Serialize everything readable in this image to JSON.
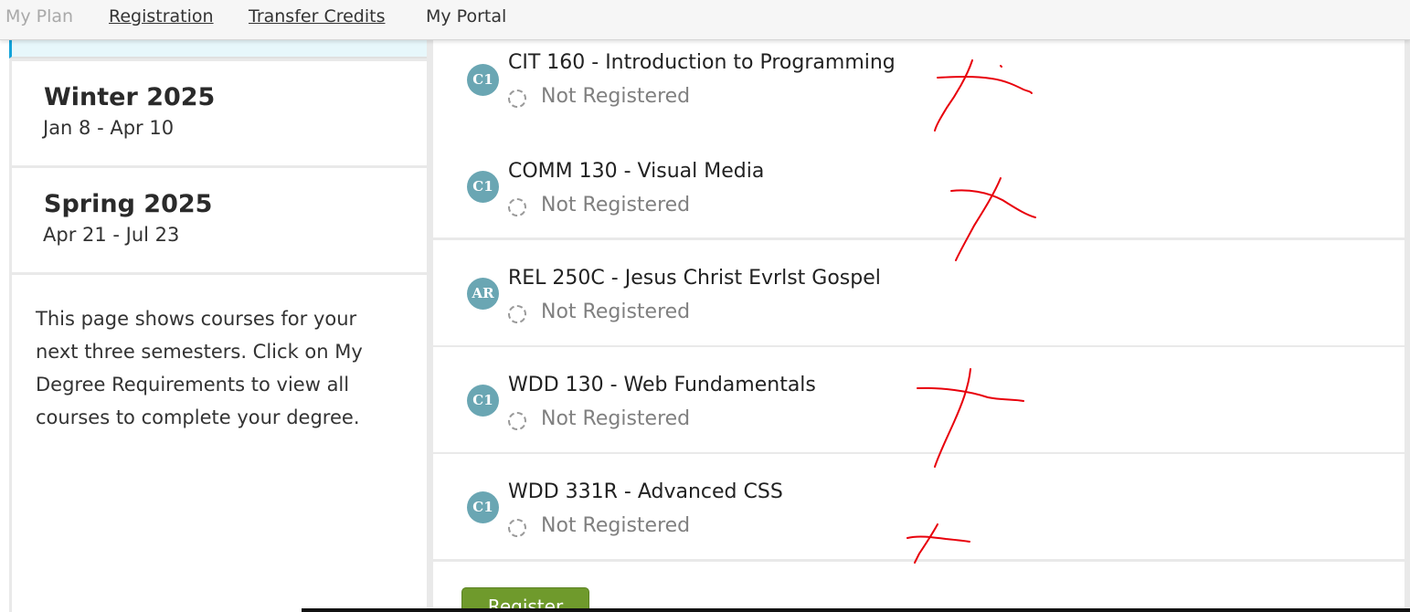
{
  "nav": {
    "my_plan": "My Plan",
    "registration": "Registration",
    "transfer_credits": "Transfer Credits",
    "my_portal": "My Portal"
  },
  "terms": [
    {
      "name": "Winter 2025",
      "dates": "Jan 8 - Apr 10"
    },
    {
      "name": "Spring 2025",
      "dates": "Apr 21 - Jul 23"
    }
  ],
  "info_text": "This page shows courses for your next three semesters. Click on My Degree Requirements to view all courses to complete your degree.",
  "courses": [
    {
      "badge": "C1",
      "title": "CIT 160 - Introduction to Programming",
      "status": "Not Registered"
    },
    {
      "badge": "C1",
      "title": "COMM 130 - Visual Media",
      "status": "Not Registered"
    },
    {
      "badge": "AR",
      "title": "REL 250C - Jesus Christ Evrlst Gospel",
      "status": "Not Registered"
    },
    {
      "badge": "C1",
      "title": "WDD 130 - Web Fundamentals",
      "status": "Not Registered"
    },
    {
      "badge": "C1",
      "title": "WDD 331R - Advanced CSS",
      "status": "Not Registered"
    }
  ],
  "register_button": "Register",
  "colors": {
    "accent": "#13a3d9",
    "badge": "#6aa6b3",
    "button": "#6f9a2c",
    "annotation": "#e8000b"
  }
}
